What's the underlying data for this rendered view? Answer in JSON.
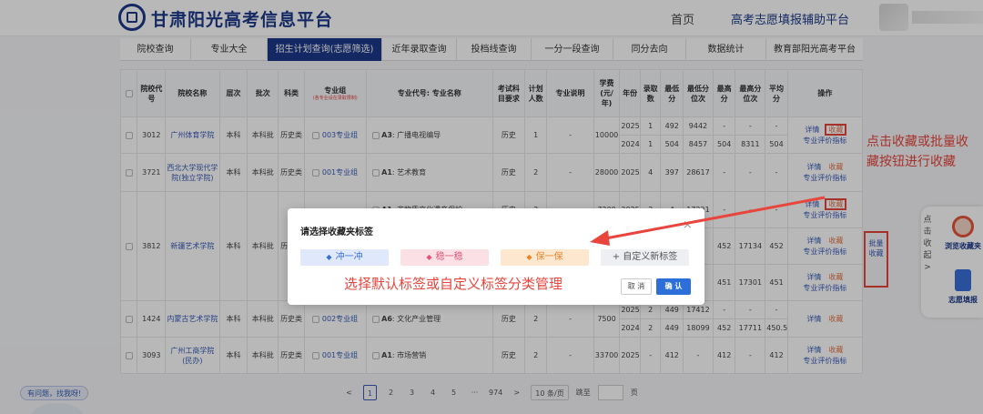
{
  "header": {
    "site_title": "甘肃阳光高考信息平台",
    "nav_home": "首页",
    "nav_helper": "高考志愿填报辅助平台"
  },
  "tabs": [
    "院校查询",
    "专业大全",
    "招生计划查询(志愿筛选)",
    "近年录取查询",
    "投档线查询",
    "一分一段查询",
    "同分去向",
    "数据统计",
    "教育部阳光高考平台"
  ],
  "table": {
    "headers": [
      "院校代号",
      "院校名称",
      "层次",
      "批次",
      "科类",
      "专业组",
      "专业代号: 专业名称",
      "考试科目要求",
      "计划人数",
      "专业说明",
      "学费(元/年)",
      "年份",
      "录取数",
      "最低分",
      "最低分位次",
      "最高分",
      "最高分位次",
      "平均分",
      "操作"
    ],
    "group_note": "(各专业设在录取限制)",
    "detail": "详情",
    "fav": "收藏",
    "eval": "专业评价指标",
    "rows": [
      {
        "code": "3012",
        "name": "广州体育学院",
        "level": "本科",
        "batch": "本科批",
        "subject": "历史类",
        "group": "003专业组",
        "major_code": "A3",
        "major": "广播电视编导",
        "req": "历史",
        "plan": "1",
        "desc": "-",
        "fee": "10000",
        "years": [
          [
            "2025",
            "1",
            "492",
            "9442",
            "-",
            "-",
            "-"
          ],
          [
            "2024",
            "1",
            "504",
            "8457",
            "504",
            "8311",
            "504"
          ]
        ]
      },
      {
        "code": "3721",
        "name": "西北大学现代学院(独立学院)",
        "level": "本科",
        "batch": "本科批",
        "subject": "历史类",
        "group": "001专业组",
        "major_code": "A1",
        "major": "艺术教育",
        "req": "历史",
        "plan": "2",
        "desc": "-",
        "fee": "28000",
        "years": [
          [
            "2025",
            "4",
            "397",
            "28617",
            "-",
            "-",
            "-"
          ]
        ]
      },
      {
        "code": "3812",
        "name": "新疆艺术学院",
        "level": "本科",
        "batch": "本科批",
        "subject": "历史类",
        "group": "",
        "major_code": "A1",
        "major": "非物质文化遗产保护",
        "req": "历史",
        "plan": "3",
        "desc": "-",
        "fee": "7200",
        "years": [
          [
            "2025",
            "3",
            "4",
            "17221",
            "-",
            "-",
            "-"
          ],
          [
            "",
            "",
            "3",
            "",
            "452",
            "17134",
            "452"
          ],
          [
            "",
            "",
            "3",
            "",
            "451",
            "17301",
            "451"
          ]
        ]
      },
      {
        "code": "1424",
        "name": "内蒙古艺术学院",
        "level": "本科",
        "batch": "本科批",
        "subject": "历史类",
        "group": "002专业组",
        "major_code": "A6",
        "major": "文化产业管理",
        "req": "历史",
        "plan": "2",
        "desc": "-",
        "fee": "7500",
        "years": [
          [
            "2025",
            "2",
            "449",
            "17412",
            "-",
            "-",
            "-"
          ],
          [
            "2024",
            "2",
            "449",
            "18099",
            "452",
            "17711",
            "450.5"
          ]
        ]
      },
      {
        "code": "3093",
        "name": "广州工商学院(民办)",
        "level": "本科",
        "batch": "本科批",
        "subject": "历史类",
        "group": "001专业组",
        "major_code": "A1",
        "major": "市场营销",
        "req": "历史",
        "plan": "2",
        "desc": "-",
        "fee": "33700",
        "years": [
          [
            "2025",
            "-",
            "412",
            "-",
            "412",
            "-",
            "412"
          ]
        ]
      }
    ]
  },
  "pager": {
    "prev": "<",
    "pages": [
      "1",
      "2",
      "3",
      "4",
      "5",
      "···",
      "974"
    ],
    "next": ">",
    "size": "10 条/页",
    "goto": "跳至",
    "page_unit": "页"
  },
  "help": "有问题，找我呀!",
  "side": {
    "collapse": "点击收起",
    "browse": "浏览收藏夹",
    "fill": "志愿填报"
  },
  "batch_fav": "批量收藏",
  "note_right": "点击收藏或批量收藏按钮进行收藏",
  "dialog": {
    "title": "请选择收藏夹标签",
    "close": "×",
    "tags": [
      "冲一冲",
      "稳一稳",
      "保一保",
      "+ 自定义新标签"
    ],
    "hint": "选择默认标签或自定义标签分类管理",
    "cancel": "取 消",
    "ok": "确 认"
  },
  "colors": {
    "brand": "#1c3a8a",
    "accent": "#2d6fd9",
    "annotation": "#e8453c"
  }
}
